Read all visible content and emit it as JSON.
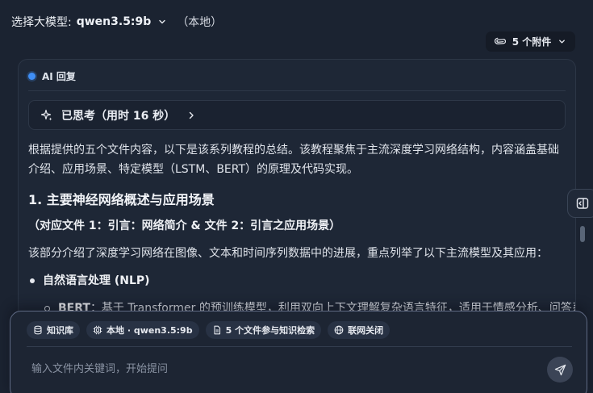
{
  "header": {
    "model_label": "选择大模型:",
    "model_name": "qwen3.5:9b",
    "model_suffix": "（本地）",
    "attachments_label": "5 个附件"
  },
  "response": {
    "badge": "AI 回复",
    "thinking_label": "已思考（用时 16 秒）",
    "intro": "根据提供的五个文件内容，以下是该系列教程的总结。该教程聚焦于主流深度学习网络结构，内容涵盖基础介绍、应用场景、特定模型（LSTM、BERT）的原理及代码实现。",
    "section_title": "1. 主要神经网络概述与应用场景",
    "section_sub": "（对应文件 1：引言：网络简介 & 文件 2：引言之应用场景）",
    "section_desc": "该部分介绍了深度学习网络在图像、文本和时间序列数据中的进展，重点列举了以下主流模型及其应用：",
    "bullet": "自然语言处理 (NLP)",
    "sub_bullet_term": "BERT",
    "sub_bullet_text": "：基于 Transformer 的预训练模型，利用双向上下文理解复杂语言特征，适用于情感分析、问答系"
  },
  "composer": {
    "chips": [
      {
        "icon": "database-icon",
        "label": "知识库"
      },
      {
        "icon": "chip-icon",
        "label": "本地 · qwen3.5:9b"
      },
      {
        "icon": "file-icon",
        "label": "5 个文件参与知识检索"
      },
      {
        "icon": "globe-icon",
        "label": "联网关闭"
      }
    ],
    "placeholder": "输入文件内关键词，开始提问"
  },
  "colors": {
    "background": "#1b2331",
    "card": "#1e2736",
    "accent": "#3f8ef5",
    "composer_border": "#5f6a84"
  }
}
